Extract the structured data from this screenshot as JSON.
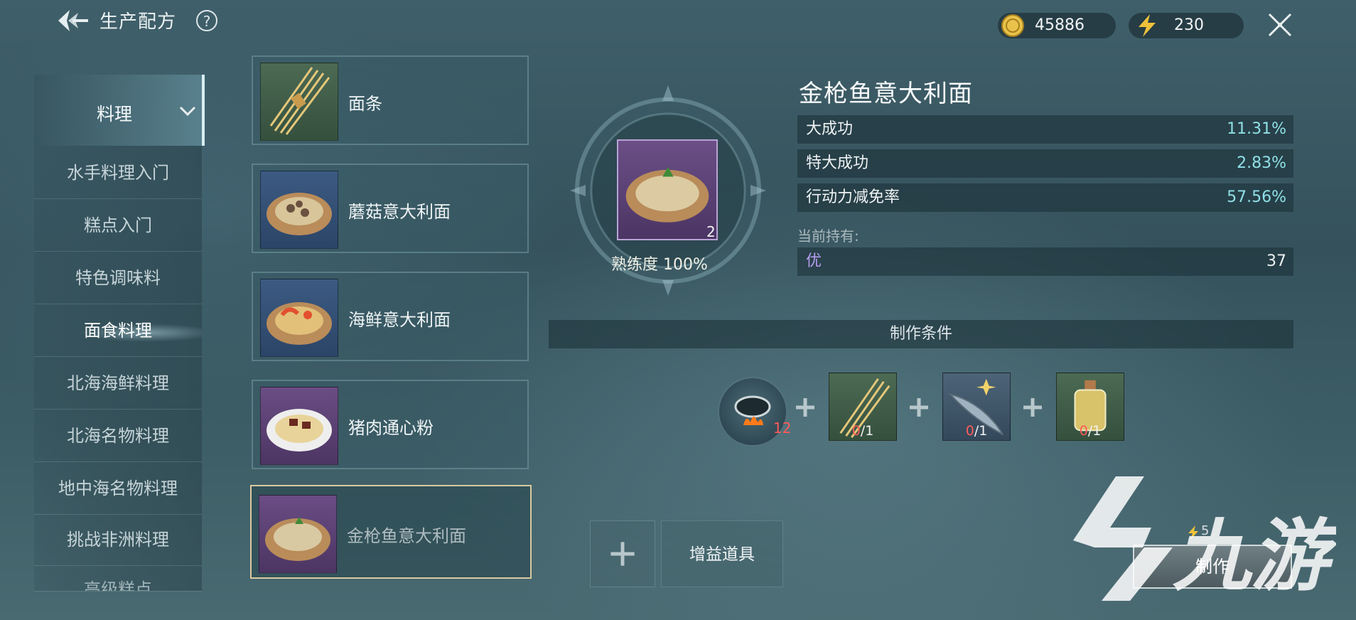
{
  "header": {
    "title": "生产配方",
    "help": "?",
    "gold": "45886",
    "energy": "230"
  },
  "categories": {
    "active": "料理",
    "items": [
      "水手料理入门",
      "糕点入门",
      "特色调味料",
      "面食料理",
      "北海海鲜料理",
      "北海名物料理",
      "地中海名物料理",
      "挑战非洲料理",
      "高级糕点"
    ],
    "selected_index": 3
  },
  "recipes": [
    {
      "name": "面条",
      "frame": "green"
    },
    {
      "name": "蘑菇意大利面",
      "frame": "blue"
    },
    {
      "name": "海鲜意大利面",
      "frame": "blue"
    },
    {
      "name": "猪肉通心粉",
      "frame": "purple"
    },
    {
      "name": "金枪鱼意大利面",
      "frame": "purple",
      "selected": true
    }
  ],
  "detail": {
    "name": "金枪鱼意大利面",
    "item_count": "2",
    "mastery": "熟练度 100%",
    "stats": [
      {
        "label": "大成功",
        "value": "11.31%"
      },
      {
        "label": "特大成功",
        "value": "2.83%"
      },
      {
        "label": "行动力减免率",
        "value": "57.56%"
      }
    ],
    "owned_label": "当前持有:",
    "owned": {
      "quality": "优",
      "count": "37"
    },
    "conditions_title": "制作条件",
    "stove_level": "12",
    "ingredients": [
      {
        "icon": "noodles-icon",
        "have": "0",
        "need": "/1"
      },
      {
        "icon": "tuna-icon",
        "have": "0",
        "need": "/1"
      },
      {
        "icon": "oil-bottle-icon",
        "have": "0",
        "need": "/1"
      }
    ]
  },
  "actions": {
    "boost": "增益道具",
    "make": "制作",
    "make_cost": "5"
  },
  "watermark": "九游",
  "colors": {
    "accent": "#8fe0e6",
    "warning": "#ff5a5a",
    "quality_purple": "#b79cf0"
  }
}
